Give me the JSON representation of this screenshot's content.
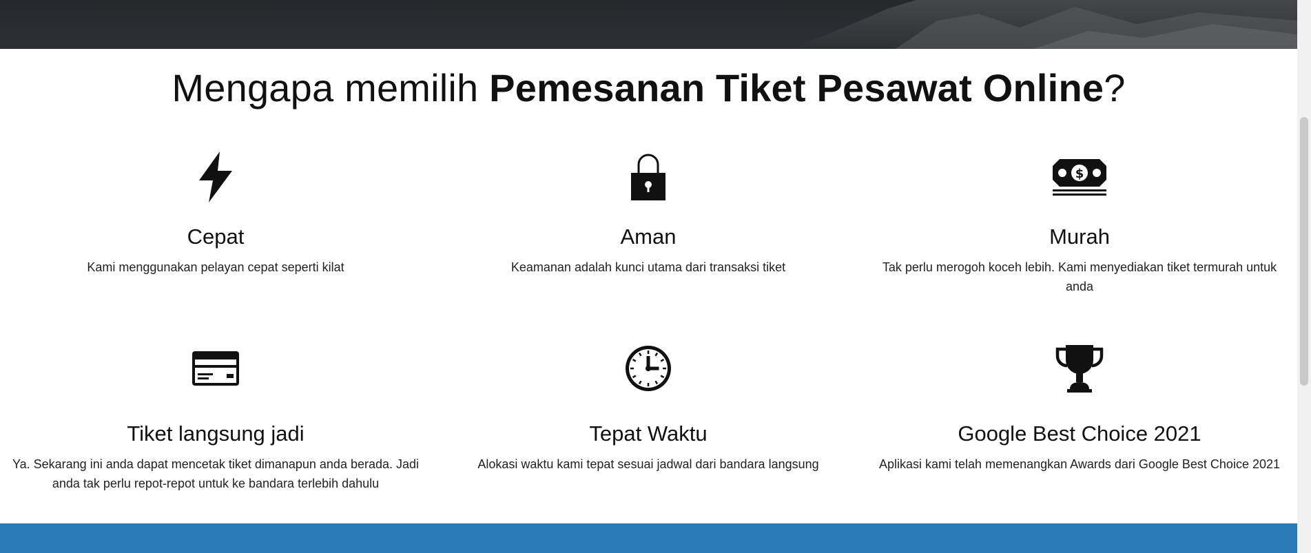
{
  "section": {
    "title_prefix": "Mengapa memilih ",
    "title_bold": "Pemesanan Tiket Pesawat Online",
    "title_suffix": "?"
  },
  "features": [
    {
      "icon": "lightning-bolt-icon",
      "title": "Cepat",
      "description": "Kami menggunakan pelayan cepat seperti kilat"
    },
    {
      "icon": "padlock-icon",
      "title": "Aman",
      "description": "Keamanan adalah kunci utama dari transaksi tiket"
    },
    {
      "icon": "money-bill-icon",
      "title": "Murah",
      "description": "Tak perlu merogoh koceh lebih. Kami menyediakan tiket termurah untuk anda"
    },
    {
      "icon": "credit-card-icon",
      "title": "Tiket langsung jadi",
      "description": "Ya. Sekarang ini anda dapat mencetak tiket dimanapun anda berada. Jadi anda tak perlu repot-repot untuk ke bandara terlebih dahulu"
    },
    {
      "icon": "clock-icon",
      "title": "Tepat Waktu",
      "description": "Alokasi waktu kami tepat sesuai jadwal dari bandara langsung"
    },
    {
      "icon": "trophy-icon",
      "title": "Google Best Choice 2021",
      "description": "Aplikasi kami telah memenangkan Awards dari Google Best Choice 2021"
    }
  ],
  "colors": {
    "hero": "#2a2c30",
    "band": "#2a7bb6",
    "text": "#111111"
  }
}
